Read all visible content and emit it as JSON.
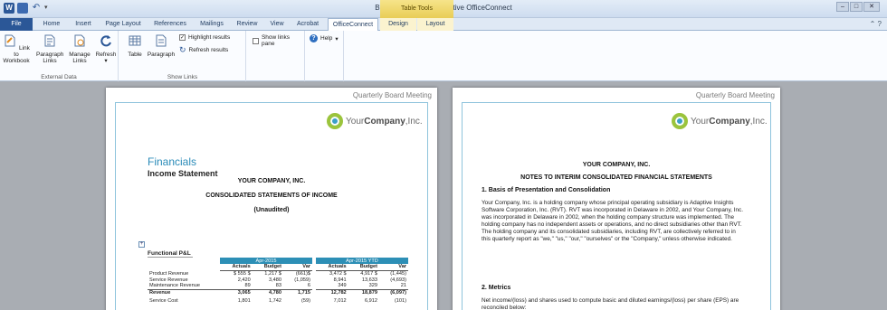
{
  "titlebar": {
    "title": "Board Book.docx - Adaptive OfficeConnect",
    "contextual_label": "Table Tools",
    "word_icon": "W"
  },
  "tabs": [
    {
      "label": "File"
    },
    {
      "label": "Home"
    },
    {
      "label": "Insert"
    },
    {
      "label": "Page Layout"
    },
    {
      "label": "References"
    },
    {
      "label": "Mailings"
    },
    {
      "label": "Review"
    },
    {
      "label": "View"
    },
    {
      "label": "Acrobat"
    },
    {
      "label": "OfficeConnect"
    },
    {
      "label": "Design"
    },
    {
      "label": "Layout"
    }
  ],
  "ribbon": {
    "external_data": {
      "label": "External Data",
      "buttons": [
        "Link to Workbook",
        "Paragraph Links",
        "Manage Links",
        "Refresh"
      ]
    },
    "show_links": {
      "label": "Show Links",
      "table": "Table",
      "paragraph": "Paragraph",
      "highlight": "Highlight results",
      "refresh_results": "Refresh results",
      "show_links_pane": "Show links pane",
      "help": "Help"
    }
  },
  "doc": {
    "header": "Quarterly Board Meeting",
    "logo_prefix": "Your",
    "logo_bold": "Company",
    "logo_suffix": ",Inc.",
    "left": {
      "heading": "Financials",
      "subheading": "Income Statement",
      "company": "YOUR COMPANY, INC.",
      "statement": "CONSOLIDATED STATEMENTS OF INCOME",
      "unaudited": "(Unaudited)",
      "section": "Functional P&L",
      "band1": "Apr-2015",
      "band2": "Apr-2015 YTD",
      "cols": [
        "Actuals",
        "Budget",
        "Var",
        "Actuals",
        "Budget",
        "Var"
      ],
      "rows": [
        {
          "label": "Product Revenue",
          "cells": [
            "$ 555 $",
            "1,217 $",
            "(661)$",
            "3,472 $",
            "4,917 $",
            "(1,445)"
          ]
        },
        {
          "label": "Service Revenue",
          "cells": [
            "2,420",
            "3,480",
            "(1,059)",
            "8,941",
            "13,633",
            "(4,693)"
          ]
        },
        {
          "label": "Maintenance Revenue",
          "cells": [
            "89",
            "83",
            "6",
            "349",
            "329",
            "21"
          ]
        },
        {
          "label": "Revenue",
          "cells": [
            "3,065",
            "4,780",
            "1,715",
            "12,782",
            "18,879",
            "(6,097)"
          ],
          "total": true
        },
        {
          "label": "Service Cost",
          "cells": [
            "1,801",
            "1,742",
            "(59)",
            "7,012",
            "6,912",
            "(101)"
          ]
        }
      ]
    },
    "right": {
      "company": "YOUR COMPANY, INC.",
      "title": "NOTES TO INTERIM CONSOLIDATED FINANCIAL STATEMENTS",
      "s1": "1. Basis of Presentation and Consolidation",
      "p1": "Your Company, Inc. is a holding company whose principal operating subsidiary is Adaptive Insights Software Corporation, Inc. (RVT). RVT was incorporated in Delaware in 2002, and Your Company, Inc. was incorporated in Delaware in 2002, when the holding company structure was implemented. The holding company has no independent assets or operations, and no direct subsidiaries other than RVT. The holding company and its consolidated subsidiaries, including RVT, are collectively referred to in this quarterly report as \"we,\" \"us,\" \"our,\" \"ourselves\" or the \"Company,\" unless otherwise indicated.",
      "s2": "2. Metrics",
      "p2": "Net income/(loss) and shares used to compute basic and diluted earnings/(loss) per share (EPS) are reconciled below:"
    }
  },
  "colors": {
    "accent": "#2b5797",
    "table_band": "#2d8fb6",
    "heading": "#2a8bb8",
    "contextual": "#e9cd56"
  }
}
